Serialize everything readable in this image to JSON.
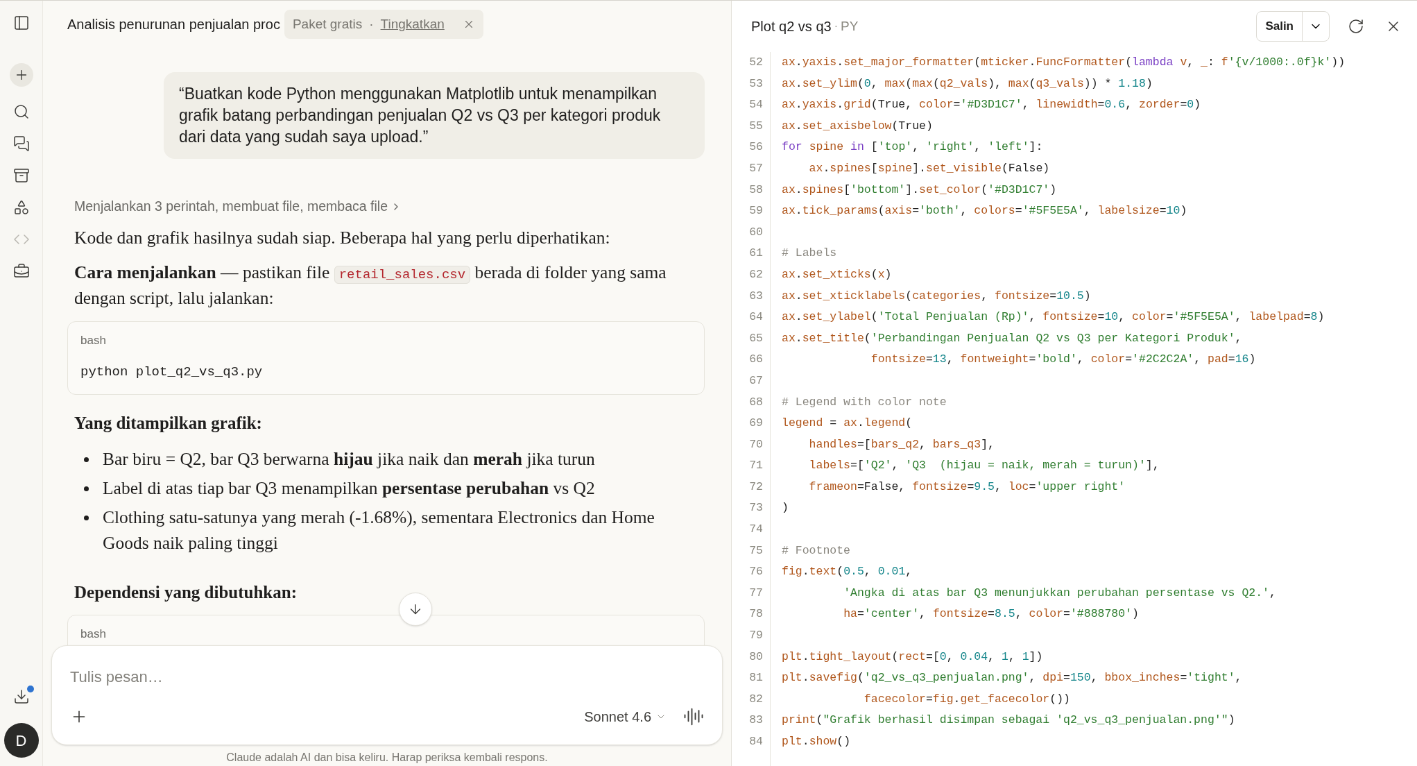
{
  "sidebar": {
    "downloads": {
      "badge": true
    },
    "avatar": {
      "initial": "D"
    }
  },
  "conversation": {
    "title": "Analisis penurunan penjualan proc",
    "plan_badge": {
      "plan": "Paket gratis",
      "separator": "·",
      "action": "Tingkatkan"
    }
  },
  "user_message": "“Buatkan kode Python menggunakan Matplotlib untuk menampilkan grafik batang perbandingan penjualan Q2 vs Q3 per kategori produk dari data yang sudah saya upload.”",
  "assistant_blocks": [
    {
      "kind": "steps",
      "text": "Menjalankan 3 perintah, membuat file, membaca file"
    },
    {
      "kind": "paragraph",
      "parts": [
        {
          "text": "Kode dan grafik hasilnya sudah siap. Beberapa hal yang perlu diperhatikan:"
        }
      ]
    },
    {
      "kind": "paragraph",
      "parts": [
        {
          "text": "**Cara menjalankan** — pastikan file "
        },
        {
          "code": "retail_sales.csv"
        },
        {
          "text": " berada di folder yang sama dengan script, lalu jalankan:"
        }
      ]
    },
    {
      "kind": "code",
      "language": "bash",
      "code": "python plot_q2_vs_q3.py"
    },
    {
      "kind": "heading",
      "text": "Yang ditampilkan grafik:"
    },
    {
      "kind": "list",
      "items": [
        "Bar biru = Q2, bar Q3 berwarna **hijau** jika naik dan **merah** jika turun",
        "Label di atas tiap bar Q3 menampilkan **persentase perubahan** vs Q2",
        "Clothing satu-satunya yang merah (-1.68%), sementara Electronics dan Home Goods naik paling tinggi"
      ]
    },
    {
      "kind": "heading",
      "text": "Dependensi yang dibutuhkan:"
    },
    {
      "kind": "code",
      "language": "bash"
    }
  ],
  "composer": {
    "placeholder": "Tulis pesan…",
    "model": "Sonnet 4.6"
  },
  "disclaimer": "Claude adalah AI dan bisa keliru. Harap periksa kembali respons.",
  "artifact": {
    "title": "Plot q2 vs q3",
    "separator": "·",
    "file_type": "PY",
    "copy_button": "Salin",
    "lines": [
      {
        "n": "52",
        "code": "ax.yaxis.set_major_formatter(mticker.FuncFormatter(lambda v, _: f'{v/1000:.0f}k'))"
      },
      {
        "n": "53",
        "code": "ax.set_ylim(0, max(max(q2_vals), max(q3_vals)) * 1.18)"
      },
      {
        "n": "54",
        "code": "ax.yaxis.grid(True, color='#D3D1C7', linewidth=0.6, zorder=0)"
      },
      {
        "n": "55",
        "code": "ax.set_axisbelow(True)"
      },
      {
        "n": "56",
        "code": "for spine in ['top', 'right', 'left']:"
      },
      {
        "n": "57",
        "code": "    ax.spines[spine].set_visible(False)"
      },
      {
        "n": "58",
        "code": "ax.spines['bottom'].set_color('#D3D1C7')"
      },
      {
        "n": "59",
        "code": "ax.tick_params(axis='both', colors='#5F5E5A', labelsize=10)"
      },
      {
        "n": "60"
      },
      {
        "n": "61",
        "code": "# Labels"
      },
      {
        "n": "62",
        "code": "ax.set_xticks(x)"
      },
      {
        "n": "63",
        "code": "ax.set_xticklabels(categories, fontsize=10.5)"
      },
      {
        "n": "64",
        "code": "ax.set_ylabel('Total Penjualan (Rp)', fontsize=10, color='#5F5E5A', labelpad=8)"
      },
      {
        "n": "65",
        "code": "ax.set_title('Perbandingan Penjualan Q2 vs Q3 per Kategori Produk',"
      },
      {
        "n": "66",
        "code": "             fontsize=13, fontweight='bold', color='#2C2C2A', pad=16)"
      },
      {
        "n": "67"
      },
      {
        "n": "68",
        "code": "# Legend with color note"
      },
      {
        "n": "69",
        "code": "legend = ax.legend("
      },
      {
        "n": "70",
        "code": "    handles=[bars_q2, bars_q3],"
      },
      {
        "n": "71",
        "code": "    labels=['Q2', 'Q3  (hijau = naik, merah = turun)'],"
      },
      {
        "n": "72",
        "code": "    frameon=False, fontsize=9.5, loc='upper right'"
      },
      {
        "n": "73",
        "code": ")"
      },
      {
        "n": "74"
      },
      {
        "n": "75",
        "code": "# Footnote"
      },
      {
        "n": "76",
        "code": "fig.text(0.5, 0.01,"
      },
      {
        "n": "77",
        "code": "         'Angka di atas bar Q3 menunjukkan perubahan persentase vs Q2.',"
      },
      {
        "n": "78",
        "code": "         ha='center', fontsize=8.5, color='#888780')"
      },
      {
        "n": "79"
      },
      {
        "n": "80",
        "code": "plt.tight_layout(rect=[0, 0.04, 1, 1])"
      },
      {
        "n": "81",
        "code": "plt.savefig('q2_vs_q3_penjualan.png', dpi=150, bbox_inches='tight',"
      },
      {
        "n": "82",
        "code": "            facecolor=fig.get_facecolor())"
      },
      {
        "n": "83",
        "code": "print(\"Grafik berhasil disimpan sebagai 'q2_vs_q3_penjualan.png'\")"
      },
      {
        "n": "84",
        "code": "plt.show()"
      }
    ]
  }
}
